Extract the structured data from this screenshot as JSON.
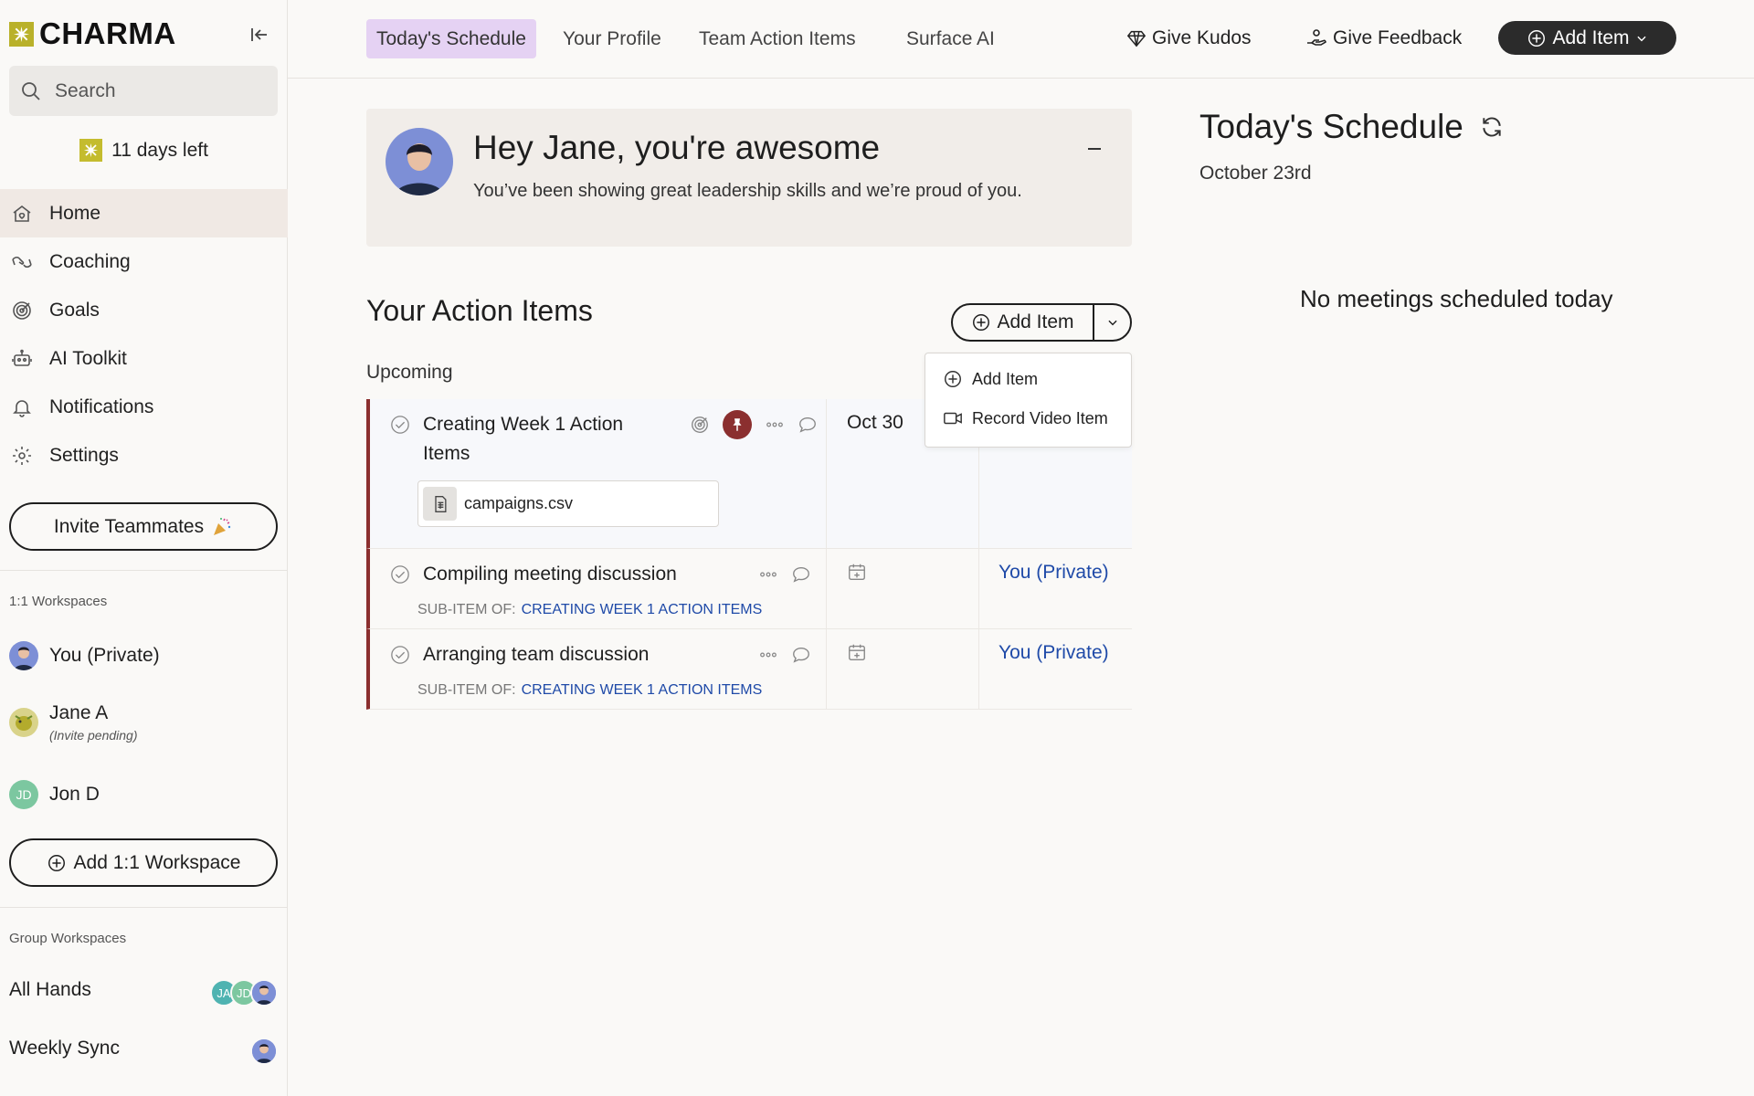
{
  "brand": {
    "name": "CHARMA",
    "accent": "#b9b12a"
  },
  "search": {
    "placeholder": "Search"
  },
  "trial": {
    "label": "11 days left"
  },
  "nav": [
    {
      "label": "Home",
      "icon": "home-icon",
      "active": true
    },
    {
      "label": "Coaching",
      "icon": "coaching-icon"
    },
    {
      "label": "Goals",
      "icon": "target-icon"
    },
    {
      "label": "AI Toolkit",
      "icon": "robot-icon"
    },
    {
      "label": "Notifications",
      "icon": "bell-icon"
    },
    {
      "label": "Settings",
      "icon": "gear-icon"
    }
  ],
  "invite": {
    "label": "Invite Teammates"
  },
  "one_on_one": {
    "section_label": "1:1 Workspaces",
    "items": [
      {
        "name": "You (Private)"
      },
      {
        "name": "Jane A",
        "sub": "(Invite pending)"
      },
      {
        "name": "Jon D",
        "initials": "JD"
      }
    ],
    "add_label": "Add 1:1 Workspace"
  },
  "group": {
    "section_label": "Group Workspaces",
    "items": [
      {
        "name": "All Hands",
        "avatars": [
          "JA",
          "JD"
        ]
      },
      {
        "name": "Weekly Sync"
      }
    ]
  },
  "topnav": {
    "tabs": [
      "Today's Schedule",
      "Your Profile",
      "Team Action Items",
      "Surface AI"
    ],
    "give_kudos": "Give Kudos",
    "give_feedback": "Give Feedback",
    "add_item": "Add Item"
  },
  "kudos": {
    "title": "Hey Jane, you're awesome",
    "text": "You’ve been showing great leadership skills and we’re proud of you."
  },
  "action_items": {
    "title": "Your Action Items",
    "add_label": "Add Item",
    "group_label": "Upcoming",
    "rows": [
      {
        "title_line1": "Creating Week 1 Action",
        "title_line2": "Items",
        "attachment": "campaigns.csv",
        "due": "Oct 30"
      },
      {
        "title": "Compiling meeting discussion",
        "sub_label": "SUB-ITEM OF:",
        "parent": "CREATING WEEK 1 ACTION ITEMS",
        "owner": "You (Private)"
      },
      {
        "title": "Arranging team discussion",
        "sub_label": "SUB-ITEM OF:",
        "parent": "CREATING WEEK 1 ACTION ITEMS",
        "owner": "You (Private)"
      }
    ]
  },
  "dropdown": {
    "items": [
      "Add Item",
      "Record Video Item"
    ]
  },
  "schedule": {
    "title": "Today's Schedule",
    "date": "October 23rd",
    "empty": "No meetings scheduled today"
  },
  "colors": {
    "active_tab": "#e5d2f3",
    "pin": "#8b2f2f",
    "link": "#1f4aa8",
    "dark_button": "#2b2b2b"
  }
}
